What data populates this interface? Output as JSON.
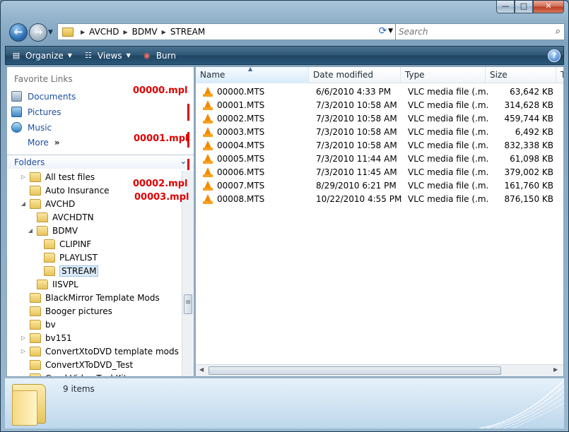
{
  "address": {
    "crumbs": [
      "AVCHD",
      "BDMV",
      "STREAM"
    ]
  },
  "search": {
    "placeholder": "Search"
  },
  "toolbar": {
    "organize": "Organize",
    "views": "Views",
    "burn": "Burn",
    "help": "?"
  },
  "favorites": {
    "title": "Favorite Links",
    "items": [
      "Documents",
      "Pictures",
      "Music",
      "More"
    ],
    "more_arrow": "»"
  },
  "folders": {
    "title": "Folders",
    "tree": [
      {
        "label": "All test files",
        "level": 0,
        "expander": "▷"
      },
      {
        "label": "Auto Insurance",
        "level": 0,
        "expander": ""
      },
      {
        "label": "AVCHD",
        "level": 0,
        "expander": "◢"
      },
      {
        "label": "AVCHDTN",
        "level": 1,
        "expander": ""
      },
      {
        "label": "BDMV",
        "level": 1,
        "expander": "◢"
      },
      {
        "label": "CLIPINF",
        "level": 2,
        "expander": ""
      },
      {
        "label": "PLAYLIST",
        "level": 2,
        "expander": ""
      },
      {
        "label": "STREAM",
        "level": 2,
        "expander": "",
        "selected": true
      },
      {
        "label": "IISVPL",
        "level": 1,
        "expander": ""
      },
      {
        "label": "BlackMirror Template Mods",
        "level": 0,
        "expander": ""
      },
      {
        "label": "Booger pictures",
        "level": 0,
        "expander": ""
      },
      {
        "label": "bv",
        "level": 0,
        "expander": ""
      },
      {
        "label": "bv151",
        "level": 0,
        "expander": "▷"
      },
      {
        "label": "ConvertXtoDVD template mods",
        "level": 0,
        "expander": "▷"
      },
      {
        "label": "ConvertXToDVD_Test",
        "level": 0,
        "expander": ""
      },
      {
        "label": "Corel Video Tool Kit",
        "level": 0,
        "expander": ""
      }
    ]
  },
  "annotations": [
    "00000.mpl",
    "00001.mpl",
    "00002.mpl",
    "00003.mpl"
  ],
  "files": {
    "columns": [
      "Name",
      "Date modified",
      "Type",
      "Size",
      "T"
    ],
    "rows": [
      {
        "name": "00000.MTS",
        "date": "6/6/2010 4:33 PM",
        "type": "VLC media file (.m...",
        "size": "63,642 KB"
      },
      {
        "name": "00001.MTS",
        "date": "7/3/2010 10:58 AM",
        "type": "VLC media file (.m...",
        "size": "314,628 KB"
      },
      {
        "name": "00002.MTS",
        "date": "7/3/2010 10:58 AM",
        "type": "VLC media file (.m...",
        "size": "459,744 KB"
      },
      {
        "name": "00003.MTS",
        "date": "7/3/2010 10:58 AM",
        "type": "VLC media file (.m...",
        "size": "6,492 KB"
      },
      {
        "name": "00004.MTS",
        "date": "7/3/2010 10:58 AM",
        "type": "VLC media file (.m...",
        "size": "832,338 KB"
      },
      {
        "name": "00005.MTS",
        "date": "7/3/2010 11:44 AM",
        "type": "VLC media file (.m...",
        "size": "61,098 KB"
      },
      {
        "name": "00006.MTS",
        "date": "7/3/2010 11:45 AM",
        "type": "VLC media file (.m...",
        "size": "379,002 KB"
      },
      {
        "name": "00007.MTS",
        "date": "8/29/2010 6:21 PM",
        "type": "VLC media file (.m...",
        "size": "161,760 KB"
      },
      {
        "name": "00008.MTS",
        "date": "10/22/2010 4:55 PM",
        "type": "VLC media file (.m...",
        "size": "876,150 KB"
      }
    ]
  },
  "status": {
    "item_count": "9 items"
  },
  "colors": {
    "annotation_red": "#e00000",
    "link_blue": "#1b4e9e",
    "toolbar_dark": "#1e4563"
  }
}
